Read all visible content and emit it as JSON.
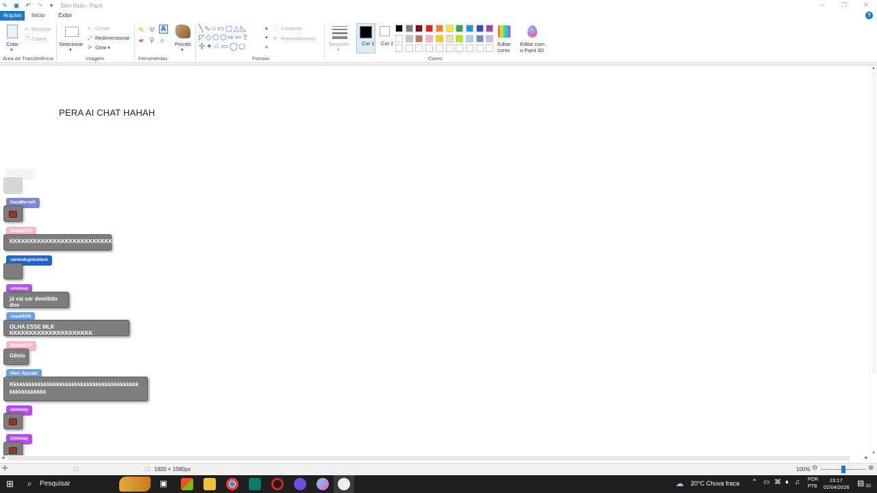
{
  "window": {
    "title": "Sem título - Paint"
  },
  "menu": {
    "tabs": [
      "Arquivo",
      "Início",
      "Exibir"
    ]
  },
  "ribbon": {
    "clipboard": {
      "paste": "Colar",
      "cut": "Recortar",
      "copy": "Copiar",
      "label": "Área de Transferência"
    },
    "image": {
      "select": "Selecionar",
      "crop": "Cortar",
      "resize": "Redimensionar",
      "rotate": "Girar",
      "label": "Imagem"
    },
    "tools": {
      "label": "Ferramentas",
      "brushes": "Pincéis"
    },
    "shapes": {
      "outline": "Contorno",
      "fill": "Preenchimento",
      "label": "Formas"
    },
    "size": {
      "label": "Tamanho"
    },
    "colors": {
      "color1": "Cor 1",
      "color2": "Cor 2",
      "edit": "Editar cores",
      "edit3d": "Editar com o Paint 3D",
      "label": "Cores",
      "row1": [
        "#000000",
        "#7f7f7f",
        "#880015",
        "#ed1c24",
        "#ff7f27",
        "#fff200",
        "#22b14c",
        "#00a2e8",
        "#3f48cc",
        "#a349a4"
      ],
      "row2": [
        "#ffffff",
        "#c3c3c3",
        "#b97a57",
        "#ffaec9",
        "#ffc90e",
        "#efe4b0",
        "#b5e61d",
        "#99d9ea",
        "#7092be",
        "#c8bfe7"
      ]
    }
  },
  "canvas": {
    "text": "PERA AI CHAT HAHAH"
  },
  "chat": [
    {
      "user": "",
      "message": "",
      "user_color": "#e6e6e6"
    },
    {
      "user": "KauaMerssi0",
      "message": "",
      "user_color": "#7b86d6"
    },
    {
      "user": "Shedu0737",
      "message": "KKKKKKKKKKKKKKKKKKKKKKKKKKKK",
      "user_color": "#f5b8cc"
    },
    {
      "user": "cortesdogokublack",
      "message": "",
      "user_color": "#1a67d2"
    },
    {
      "user": "notedaay",
      "message": "já vai ser demitido dnv",
      "user_color": "#b44ee8"
    },
    {
      "user": "JoaoPEPR",
      "message": "OLHA ESSE MLK KKKKKKKKKKKKKKKKKKKKK",
      "user_color": "#6a9fe8"
    },
    {
      "user": "Shedu0737",
      "message": "Gênio",
      "user_color": "#f5b8cc"
    },
    {
      "user": "Hiori_Ryuzaki",
      "message_line1": "Kkkkkkkkkkkkkkkkkkkkkkkkkkkkkkkkkkkkkkkkkk",
      "message_line2": "kkkkkkkkkkkk",
      "user_color": "#6a9fe8"
    },
    {
      "user": "notedaay",
      "message": "",
      "user_color": "#b44ee8"
    },
    {
      "user": "notedaay",
      "message": "",
      "user_color": "#b44ee8"
    }
  ],
  "status": {
    "dimensions": "1920 × 1080px",
    "zoom": "100%"
  },
  "taskbar": {
    "search": "Pesquisar",
    "weather": "20°C  Chuva fraca",
    "lang1": "POR",
    "lang2": "PTB",
    "time": "23:17",
    "date": "02/04/2026",
    "notifications": "12"
  }
}
